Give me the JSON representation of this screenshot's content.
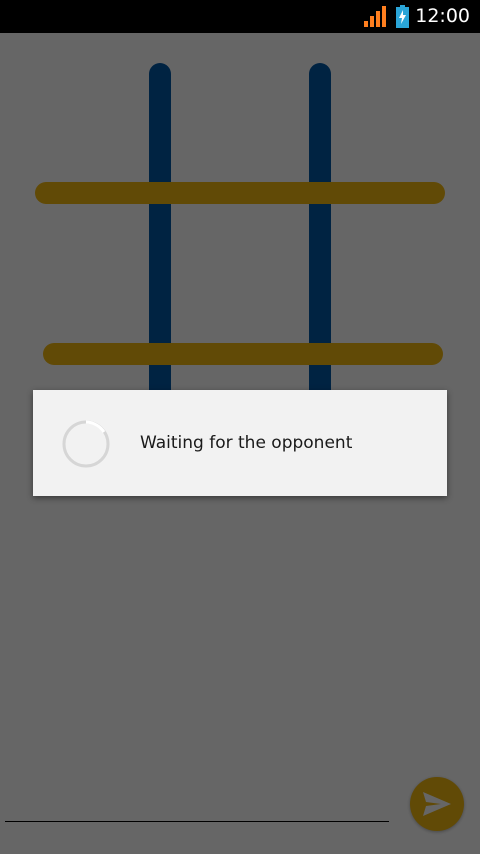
{
  "status_bar": {
    "time": "12:00",
    "signal_icon": "signal-strength-icon",
    "battery_icon": "battery-charging-icon",
    "accent_color": "#ff7f1f"
  },
  "board": {
    "vertical_line_color": "#0057a6",
    "horizontal_line_color": "#f2b811",
    "background_color": "#ffffff"
  },
  "composer": {
    "message_placeholder": "",
    "send_icon": "send-icon",
    "send_button_color": "#f2b811"
  },
  "dialog": {
    "message": "Waiting for the opponent",
    "spinner_icon": "progress-spinner-icon"
  }
}
